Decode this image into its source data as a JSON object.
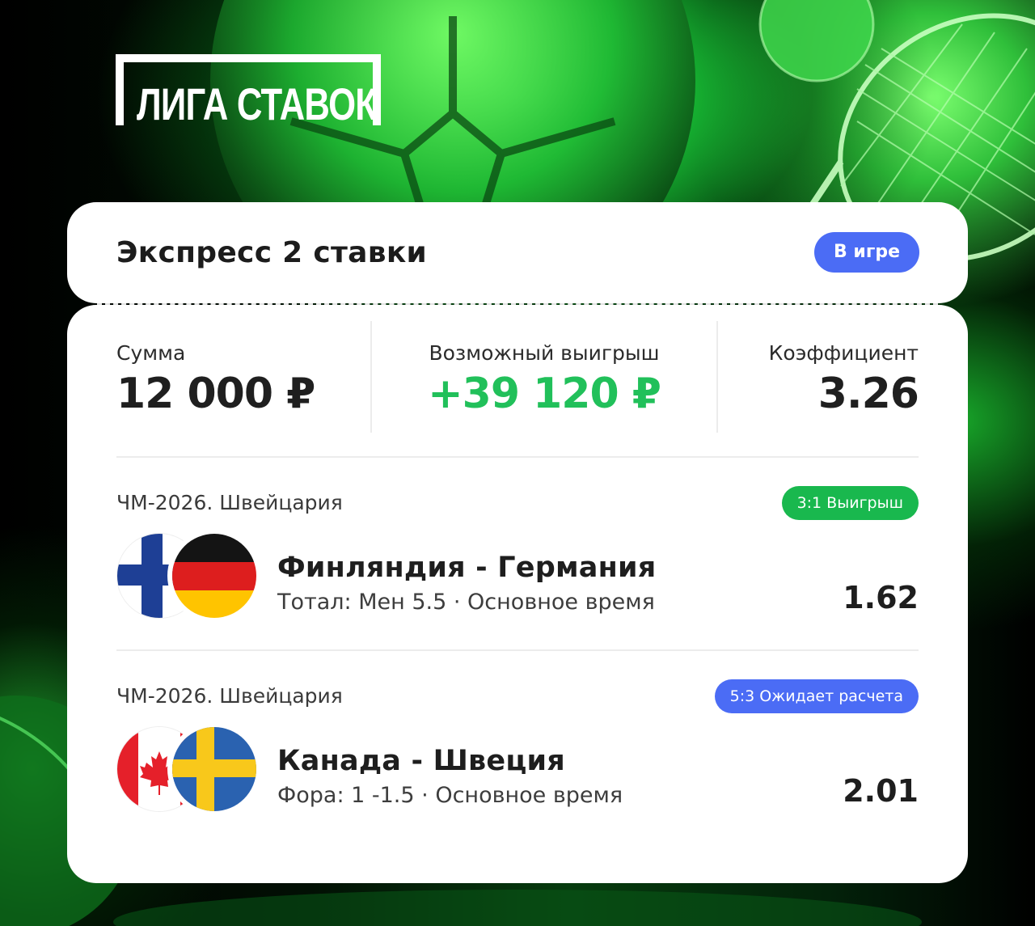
{
  "brand": {
    "logo_text": "ЛИГА СТАВОК"
  },
  "bet": {
    "title": "Экспресс 2 ставки",
    "status": "В игре",
    "stake_label": "Сумма",
    "stake_value": "12 000 ₽",
    "payout_label": "Возможный выигрыш",
    "payout_value": "+39 120 ₽",
    "coef_label": "Коэффициент",
    "coef_value": "3.26"
  },
  "events": [
    {
      "league": "ЧМ-2026. Швейцария",
      "badge": "3:1 Выигрыш",
      "badge_color": "#19b84e",
      "teams": "Финляндия - Германия",
      "market": "Тотал: Мен 5.5 · Основное время",
      "odds": "1.62",
      "flags": [
        "finland-flag-icon",
        "germany-flag-icon"
      ]
    },
    {
      "league": "ЧМ-2026. Швейцария",
      "badge": "5:3 Ожидает расчета",
      "badge_color": "#4b6cf5",
      "teams": "Канада - Швеция",
      "market": "Фора: 1 -1.5 · Основное время",
      "odds": "2.01",
      "flags": [
        "canada-flag-icon",
        "sweden-flag-icon"
      ]
    }
  ],
  "colors": {
    "accent_green": "#21c05a",
    "status_blue": "#4b6cf5",
    "win_green": "#19b84e"
  }
}
